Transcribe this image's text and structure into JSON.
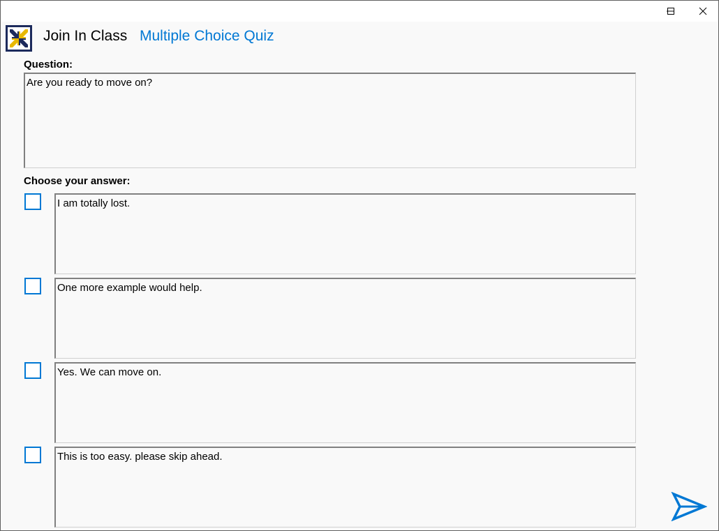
{
  "window": {
    "controls": {
      "minimize_icon": "minimize-icon",
      "maximize_icon": "maximize-icon",
      "close_icon": "close-icon"
    }
  },
  "header": {
    "logo_icon": "join-in-class-logo-icon",
    "app_name": "Join In Class",
    "quiz_type": "Multiple Choice Quiz",
    "accent_color": "#0078d4"
  },
  "question": {
    "label": "Question:",
    "text": "Are you ready to move on?"
  },
  "answers": {
    "label": "Choose your answer:",
    "options": [
      {
        "text": "I am totally lost.",
        "checked": false
      },
      {
        "text": "One more example would help.",
        "checked": false
      },
      {
        "text": "Yes. We can move on.",
        "checked": false
      },
      {
        "text": "This is too easy. please skip ahead.",
        "checked": false
      }
    ]
  },
  "submit": {
    "icon": "send-icon"
  }
}
